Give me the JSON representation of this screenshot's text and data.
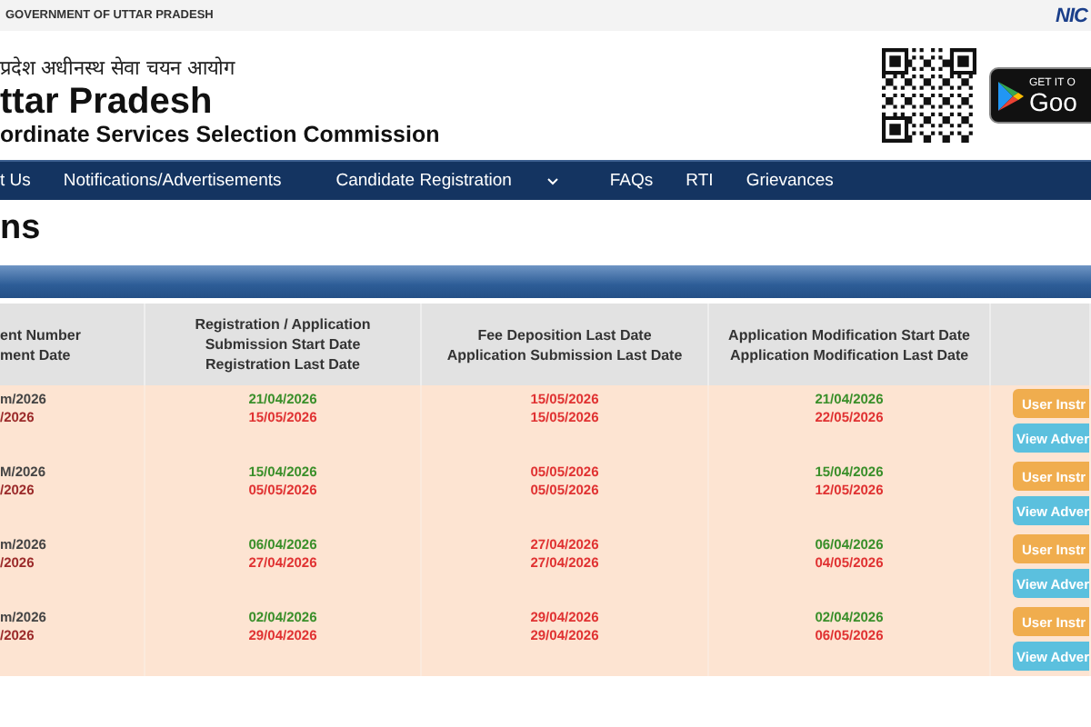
{
  "top_bar": {
    "title": "GOVERNMENT OF UTTAR PRADESH",
    "logo": "NIC"
  },
  "header": {
    "hindi_title": "प्रदेश अधीनस्थ सेवा चयन आयोग",
    "title": "ttar Pradesh",
    "subtitle": "ordinate Services Selection Commission",
    "store_badge": {
      "caption": "GET IT O",
      "name": "Goo"
    }
  },
  "nav": {
    "items": [
      {
        "label": "t Us",
        "has_dropdown": false
      },
      {
        "label": "Notifications/Advertisements",
        "has_dropdown": false
      },
      {
        "label": "Candidate Registration",
        "has_dropdown": true
      },
      {
        "label": "FAQs",
        "has_dropdown": false
      },
      {
        "label": "RTI",
        "has_dropdown": false
      },
      {
        "label": "Grievances",
        "has_dropdown": false
      }
    ]
  },
  "page_title": "ns",
  "table": {
    "columns": [
      "ent Number\nment Date",
      "Registration / Application\nSubmission  Start Date\nRegistration Last Date",
      "Fee Deposition Last Date\nApplication Submission Last Date",
      "Application Modification Start Date\nApplication Modification Last Date"
    ],
    "rows": [
      {
        "cells": [
          [
            {
              "text": "m/2026",
              "kind": "number"
            },
            {
              "text": "/2026",
              "kind": "date"
            }
          ],
          [
            {
              "text": "21/04/2026",
              "kind": "start"
            },
            {
              "text": "15/05/2026",
              "kind": "end"
            }
          ],
          [
            {
              "text": "15/05/2026",
              "kind": "end"
            },
            {
              "text": "15/05/2026",
              "kind": "end"
            }
          ],
          [
            {
              "text": "21/04/2026",
              "kind": "start"
            },
            {
              "text": "22/05/2026",
              "kind": "end"
            }
          ]
        ],
        "buttons": [
          "User Instr",
          "View Adver"
        ]
      },
      {
        "cells": [
          [
            {
              "text": "M/2026",
              "kind": "number"
            },
            {
              "text": "/2026",
              "kind": "date"
            }
          ],
          [
            {
              "text": "15/04/2026",
              "kind": "start"
            },
            {
              "text": "05/05/2026",
              "kind": "end"
            }
          ],
          [
            {
              "text": "05/05/2026",
              "kind": "end"
            },
            {
              "text": "05/05/2026",
              "kind": "end"
            }
          ],
          [
            {
              "text": "15/04/2026",
              "kind": "start"
            },
            {
              "text": "12/05/2026",
              "kind": "end"
            }
          ]
        ],
        "buttons": [
          "User Instr",
          "View Adver"
        ]
      },
      {
        "cells": [
          [
            {
              "text": "m/2026",
              "kind": "number"
            },
            {
              "text": "/2026",
              "kind": "date"
            }
          ],
          [
            {
              "text": "06/04/2026",
              "kind": "start"
            },
            {
              "text": "27/04/2026",
              "kind": "end"
            }
          ],
          [
            {
              "text": "27/04/2026",
              "kind": "end"
            },
            {
              "text": "27/04/2026",
              "kind": "end"
            }
          ],
          [
            {
              "text": "06/04/2026",
              "kind": "start"
            },
            {
              "text": "04/05/2026",
              "kind": "end"
            }
          ]
        ],
        "buttons": [
          "User Instr",
          "View Adver"
        ]
      },
      {
        "cells": [
          [
            {
              "text": "m/2026",
              "kind": "number"
            },
            {
              "text": "/2026",
              "kind": "date"
            }
          ],
          [
            {
              "text": "02/04/2026",
              "kind": "start"
            },
            {
              "text": "29/04/2026",
              "kind": "end"
            }
          ],
          [
            {
              "text": "29/04/2026",
              "kind": "end"
            },
            {
              "text": "29/04/2026",
              "kind": "end"
            }
          ],
          [
            {
              "text": "02/04/2026",
              "kind": "start"
            },
            {
              "text": "06/05/2026",
              "kind": "end"
            }
          ]
        ],
        "buttons": [
          "User Instr",
          "View Adver"
        ]
      }
    ]
  }
}
